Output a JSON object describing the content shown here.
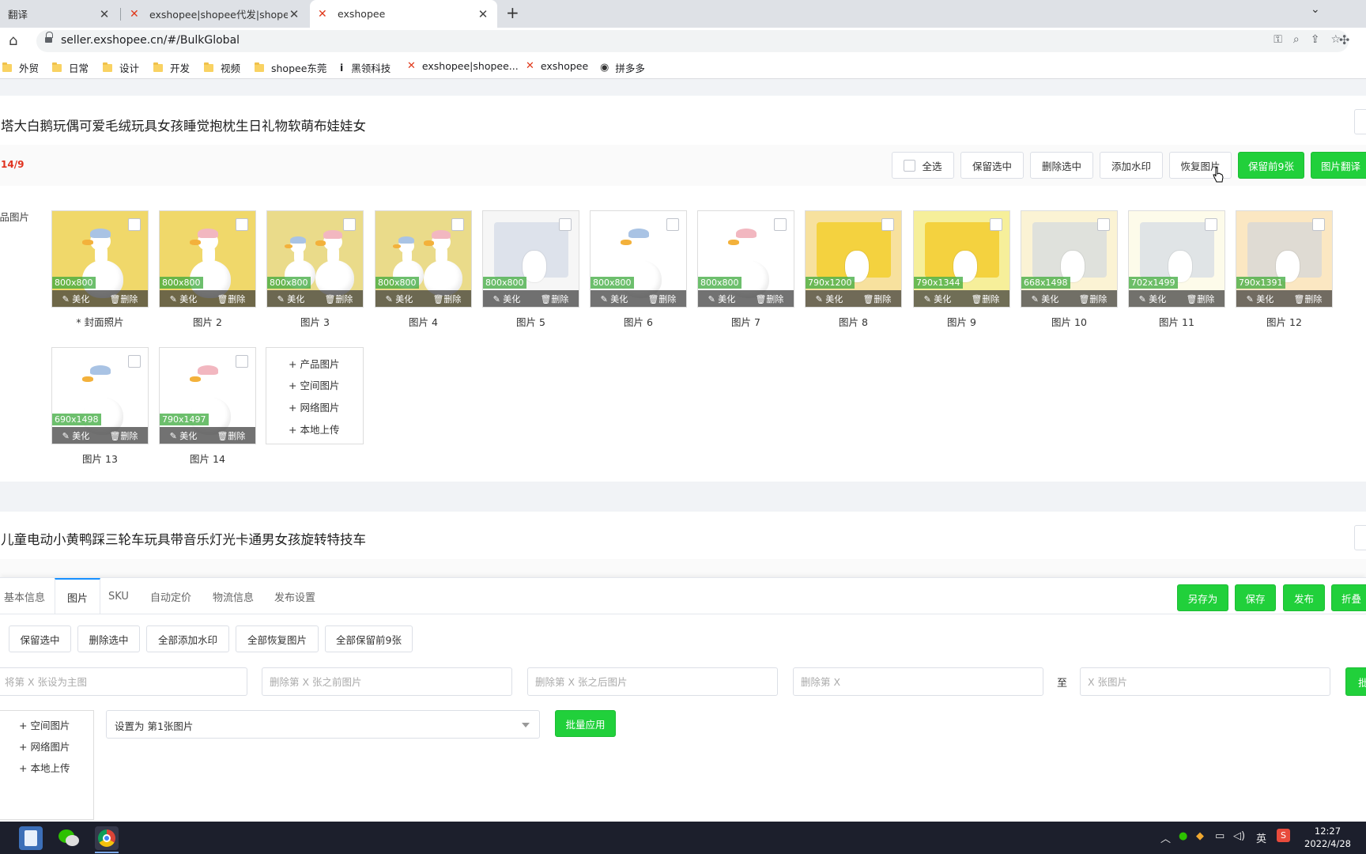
{
  "browser": {
    "tabs": [
      {
        "title": "翻译",
        "active": false
      },
      {
        "title": "exshopee|shopee代发|shopee代",
        "active": false
      },
      {
        "title": "exshopee",
        "active": true
      }
    ],
    "url": "seller.exshopee.cn/#/BulkGlobal",
    "bookmarks": [
      {
        "label": "外贸",
        "icon": "folder"
      },
      {
        "label": "日常",
        "icon": "folder"
      },
      {
        "label": "设计",
        "icon": "folder"
      },
      {
        "label": "开发",
        "icon": "folder"
      },
      {
        "label": "视频",
        "icon": "folder"
      },
      {
        "label": "shopee东莞",
        "icon": "folder"
      },
      {
        "label": "黑领科技",
        "icon": "info"
      },
      {
        "label": "exshopee|shopee...",
        "icon": "exshopee"
      },
      {
        "label": "exshopee",
        "icon": "exshopee"
      },
      {
        "label": "拼多多",
        "icon": "globe"
      }
    ]
  },
  "product1": {
    "title": "塔大白鹅玩偶可爱毛绒玩具女孩睡觉抱枕生日礼物软萌布娃娃女",
    "count": "14/9",
    "side_label": "商品图片",
    "actions": {
      "select_all": "全选",
      "keep_selected": "保留选中",
      "delete_selected": "删除选中",
      "add_watermark": "添加水印",
      "restore_images": "恢复图片",
      "keep_first": "保留前9张",
      "translate": "图片翻译"
    },
    "image_actions": {
      "beautify": "美化",
      "delete": "删除"
    },
    "images": [
      {
        "dim": "800x800",
        "caption": "* 封面照片"
      },
      {
        "dim": "800x800",
        "caption": "图片 2"
      },
      {
        "dim": "800x800",
        "caption": "图片 3"
      },
      {
        "dim": "800x800",
        "caption": "图片 4"
      },
      {
        "dim": "800x800",
        "caption": "图片 5"
      },
      {
        "dim": "800x800",
        "caption": "图片 6"
      },
      {
        "dim": "800x800",
        "caption": "图片 7"
      },
      {
        "dim": "790x1200",
        "caption": "图片 8"
      },
      {
        "dim": "790x1344",
        "caption": "图片 9"
      },
      {
        "dim": "668x1498",
        "caption": "图片 10"
      },
      {
        "dim": "702x1499",
        "caption": "图片 11"
      },
      {
        "dim": "790x1391",
        "caption": "图片 12"
      },
      {
        "dim": "690x1498",
        "caption": "图片 13"
      },
      {
        "dim": "790x1497",
        "caption": "图片 14"
      }
    ],
    "add_options": [
      "产品图片",
      "空间图片",
      "网络图片",
      "本地上传"
    ]
  },
  "product2": {
    "title": "儿童电动小黄鸭踩三轮车玩具带音乐灯光卡通男女孩旋转特技车"
  },
  "bottom_panel": {
    "tabs": [
      "基本信息",
      "图片",
      "SKU",
      "自动定价",
      "物流信息",
      "发布设置"
    ],
    "active_tab": "图片",
    "buttons_right": {
      "save_as": "另存为",
      "save": "保存",
      "publish": "发布",
      "collapse": "折叠"
    },
    "bulk_buttons": [
      "保留选中",
      "删除选中",
      "全部添加水印",
      "全部恢复图片",
      "全部保留前9张"
    ],
    "inputs": {
      "set_main": "将第 X 张设为主图",
      "delete_before": "删除第 X 张之前图片",
      "delete_after": "删除第 X 张之后图片",
      "delete_range_from": "删除第 X",
      "range_to": "至",
      "delete_range_to": "X 张图片"
    },
    "batch_label": "批",
    "add_options": [
      "空间图片",
      "网络图片",
      "本地上传"
    ],
    "select_value": "设置为 第1张图片",
    "apply_button": "批量应用"
  },
  "taskbar": {
    "time": "12:27",
    "date": "2022/4/28",
    "ime": "英"
  },
  "colors": {
    "green": "#21d03b",
    "red_count": "#e0321e",
    "active_tab_border": "#1890ff"
  }
}
